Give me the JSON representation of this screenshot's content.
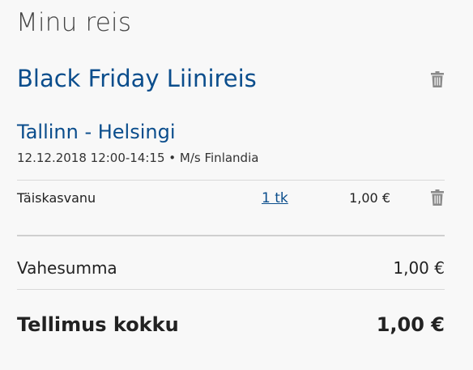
{
  "panel": {
    "title": "Minu reis"
  },
  "trip": {
    "name": "Black Friday Liinireis",
    "route": "Tallinn - Helsingi",
    "details": "12.12.2018 12:00-14:15 • M/s Finlandia"
  },
  "line_item": {
    "passenger_type": "Täiskasvanu",
    "quantity": "1 tk",
    "price": "1,00 €"
  },
  "summary": {
    "subtotal_label": "Vahesumma",
    "subtotal_value": "1,00 €",
    "total_label": "Tellimus kokku",
    "total_value": "1,00 €"
  },
  "colors": {
    "accent": "#0a4d8c",
    "icon": "#8a8a8a"
  }
}
